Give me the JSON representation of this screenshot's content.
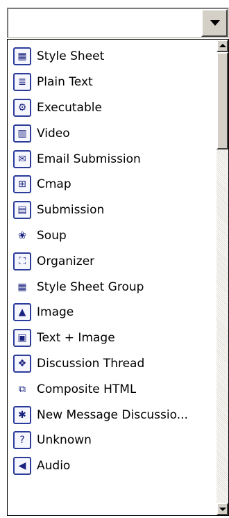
{
  "combo": {
    "value": "",
    "button_icon": "chevron-down-icon"
  },
  "list": {
    "items": [
      {
        "label": "Style Sheet",
        "icon": "style-sheet-icon",
        "glyph": "▦"
      },
      {
        "label": "Plain Text",
        "icon": "plain-text-icon",
        "glyph": "≣"
      },
      {
        "label": "Executable",
        "icon": "executable-icon",
        "glyph": "⚙"
      },
      {
        "label": "Video",
        "icon": "video-icon",
        "glyph": "▥"
      },
      {
        "label": "Email Submission",
        "icon": "email-submission-icon",
        "glyph": "✉"
      },
      {
        "label": "Cmap",
        "icon": "cmap-icon",
        "glyph": "⊞"
      },
      {
        "label": "Submission",
        "icon": "submission-icon",
        "glyph": "▤"
      },
      {
        "label": "Soup",
        "icon": "soup-icon",
        "glyph": "❀"
      },
      {
        "label": "Organizer",
        "icon": "organizer-icon",
        "glyph": "⛶"
      },
      {
        "label": "Style Sheet Group",
        "icon": "style-sheet-group-icon",
        "glyph": "▦"
      },
      {
        "label": "Image",
        "icon": "image-icon",
        "glyph": "▲"
      },
      {
        "label": "Text + Image",
        "icon": "text-image-icon",
        "glyph": "▣"
      },
      {
        "label": "Discussion Thread",
        "icon": "discussion-thread-icon",
        "glyph": "❖"
      },
      {
        "label": "Composite HTML",
        "icon": "composite-html-icon",
        "glyph": "⧉"
      },
      {
        "label": "New Message Discussio...",
        "icon": "new-message-discussion-icon",
        "glyph": "✱"
      },
      {
        "label": "Unknown",
        "icon": "unknown-icon",
        "glyph": "?"
      },
      {
        "label": "Audio",
        "icon": "audio-icon",
        "glyph": "◀"
      }
    ]
  },
  "scrollbar": {
    "up_icon": "scroll-up-arrow-icon",
    "down_icon": "scroll-down-arrow-icon"
  }
}
